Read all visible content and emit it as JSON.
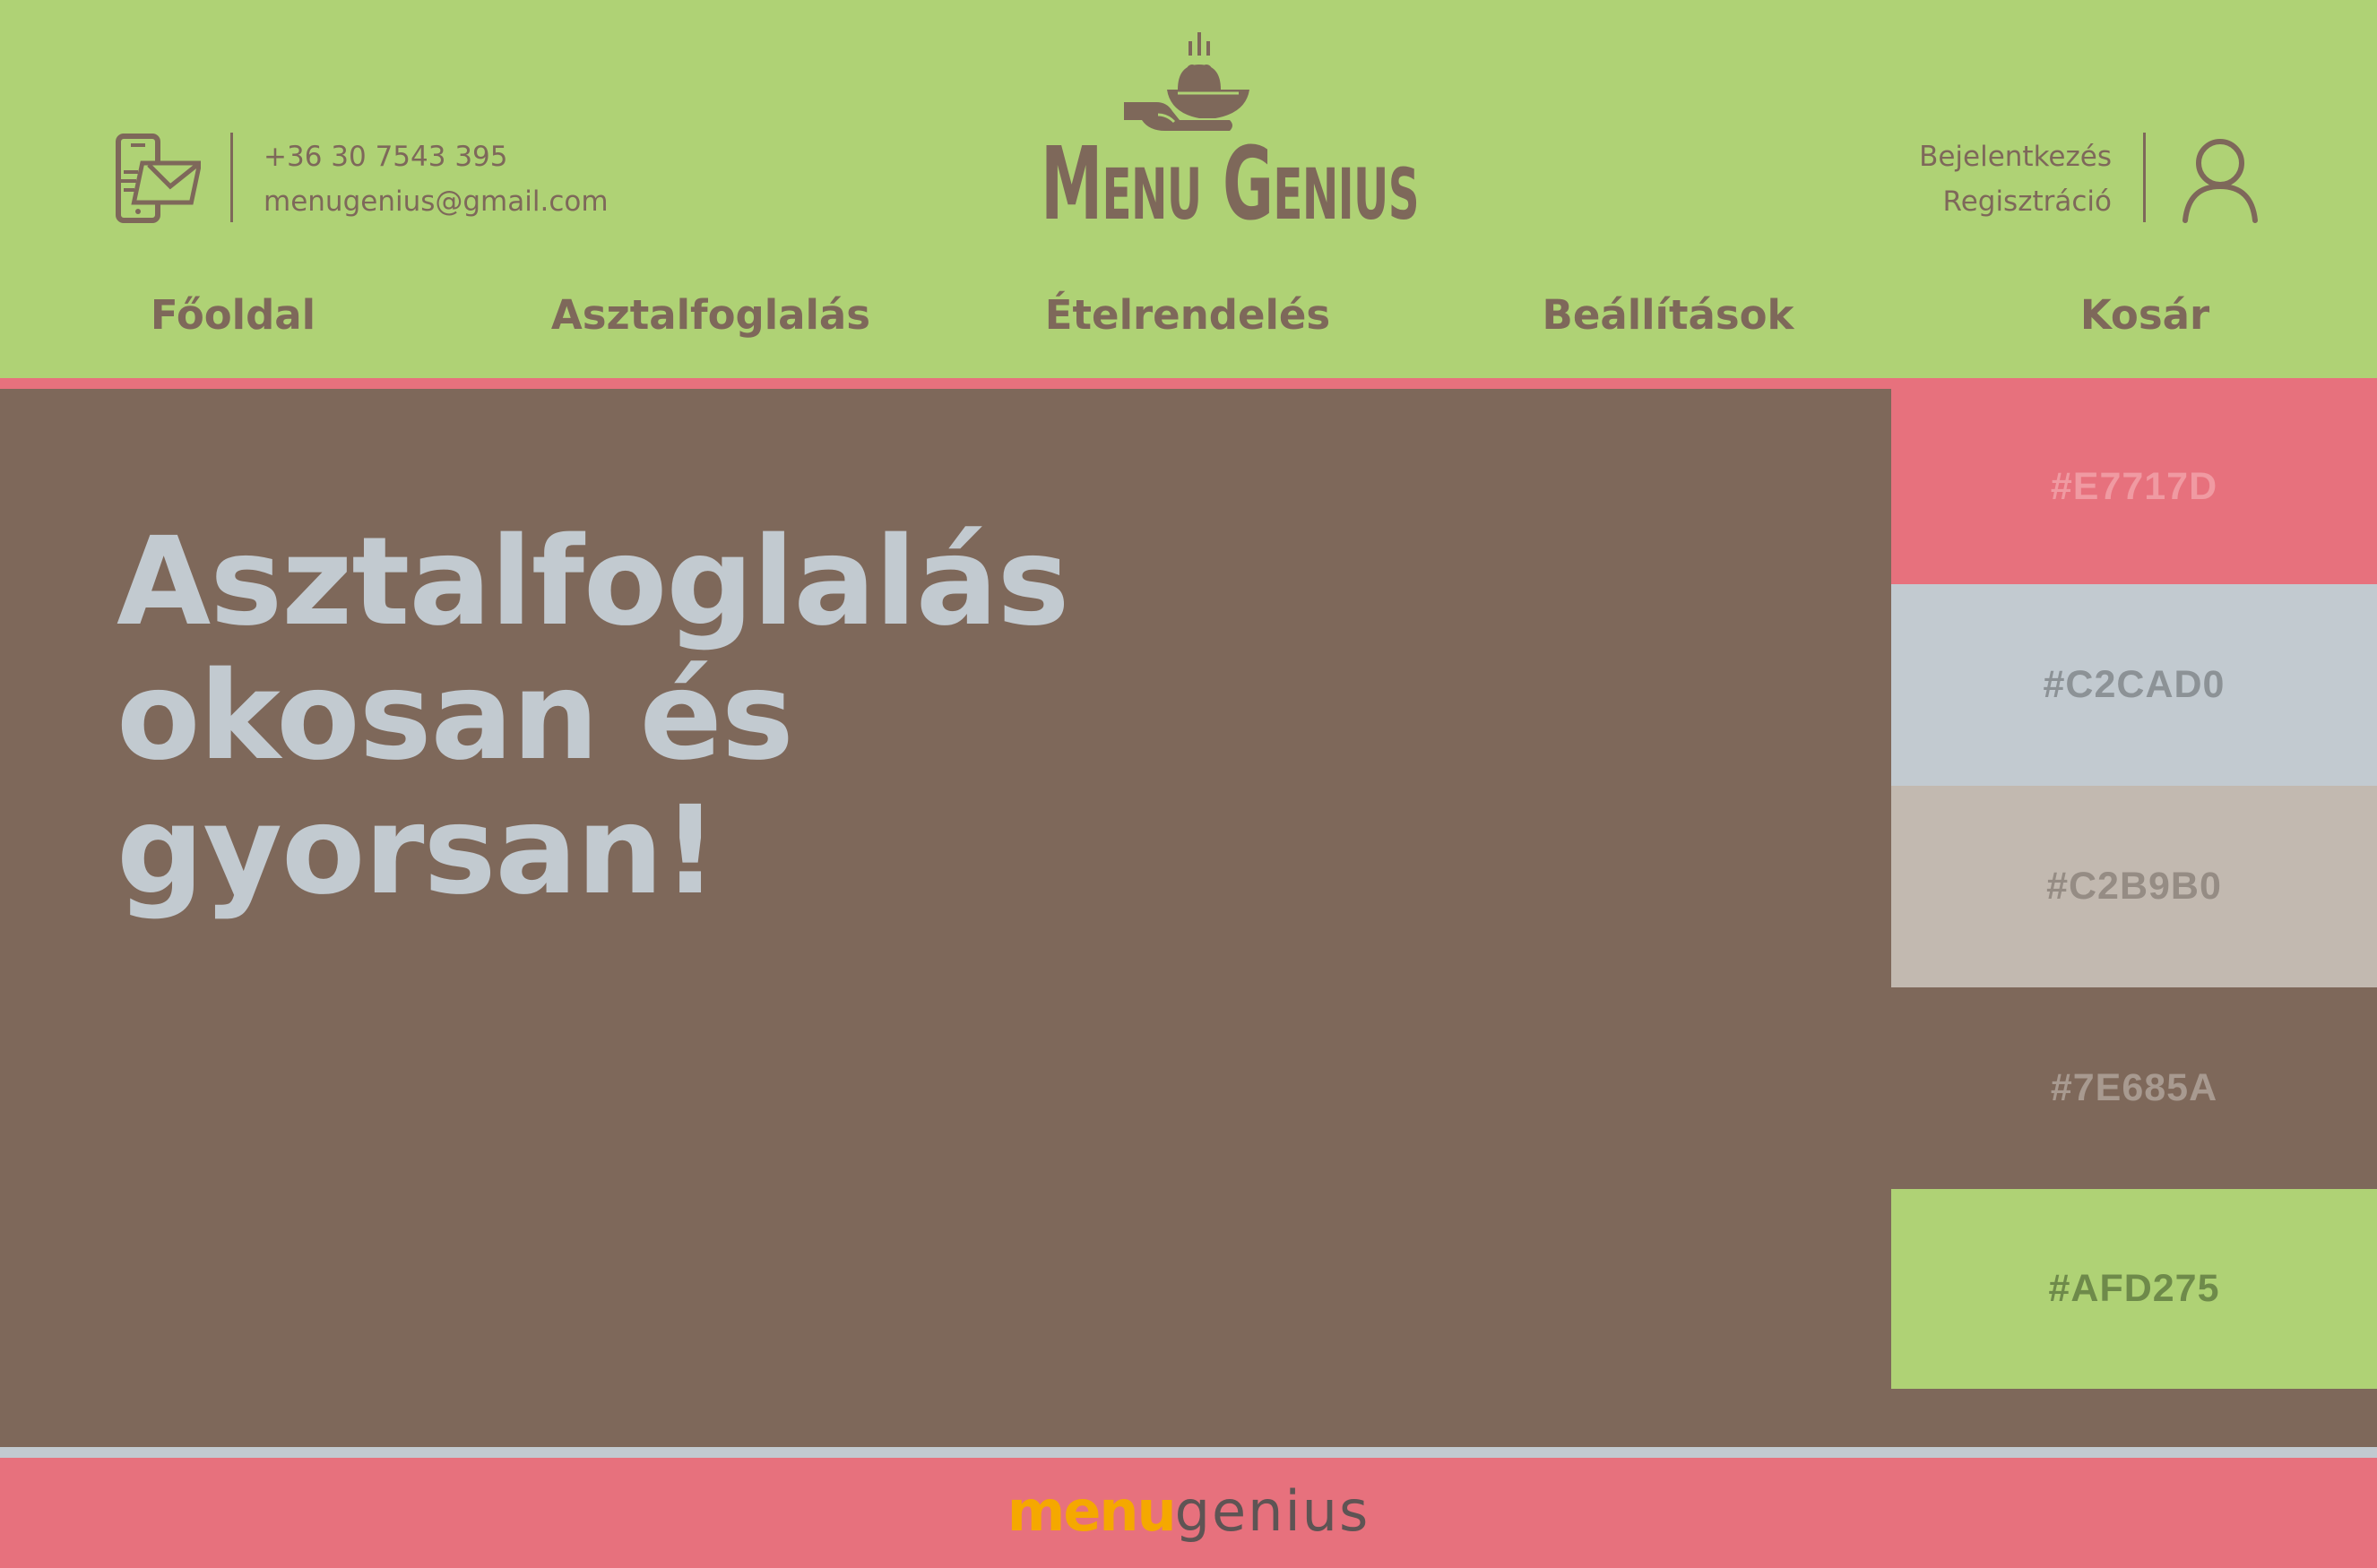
{
  "header": {
    "phone": "+36 30 7543 395",
    "email": "menugenius@gmail.com",
    "logo_text": "Menu Genius",
    "login_link": "Bejelentkezés",
    "register_link": "Regisztráció"
  },
  "nav": {
    "items": [
      {
        "label": "Főoldal"
      },
      {
        "label": "Asztalfoglalás"
      },
      {
        "label": "Ételrendelés"
      },
      {
        "label": "Beállítások"
      },
      {
        "label": "Kosár"
      }
    ]
  },
  "hero": {
    "title_lines": [
      "Asztalfoglalás",
      "okosan és",
      "gyorsan!"
    ]
  },
  "palette": {
    "swatches": [
      {
        "hex": "#E7717D",
        "bg": "#E7717D",
        "text_color": "#F09AA2"
      },
      {
        "hex": "#C2CAD0",
        "bg": "#C2CAD0",
        "text_color": "#8C9296"
      },
      {
        "hex": "#C2B9B0",
        "bg": "#C2B9B0",
        "text_color": "#958C84"
      },
      {
        "hex": "#7E685A",
        "bg": "#7E685A",
        "text_color": "#A89A90"
      },
      {
        "hex": "#AFD275",
        "bg": "#AFD275",
        "text_color": "#6E8A4A"
      }
    ]
  },
  "footer": {
    "logo_menu": "menu",
    "logo_genius": "genius"
  },
  "colors": {
    "green": "#AFD275",
    "pink": "#E7717D",
    "light_gray": "#C2CAD0",
    "beige": "#C2B9B0",
    "brown": "#7E685A"
  },
  "icons": {
    "contact": "phone-mail-icon",
    "logo": "serving-hand-dish-icon",
    "user": "user-icon"
  }
}
